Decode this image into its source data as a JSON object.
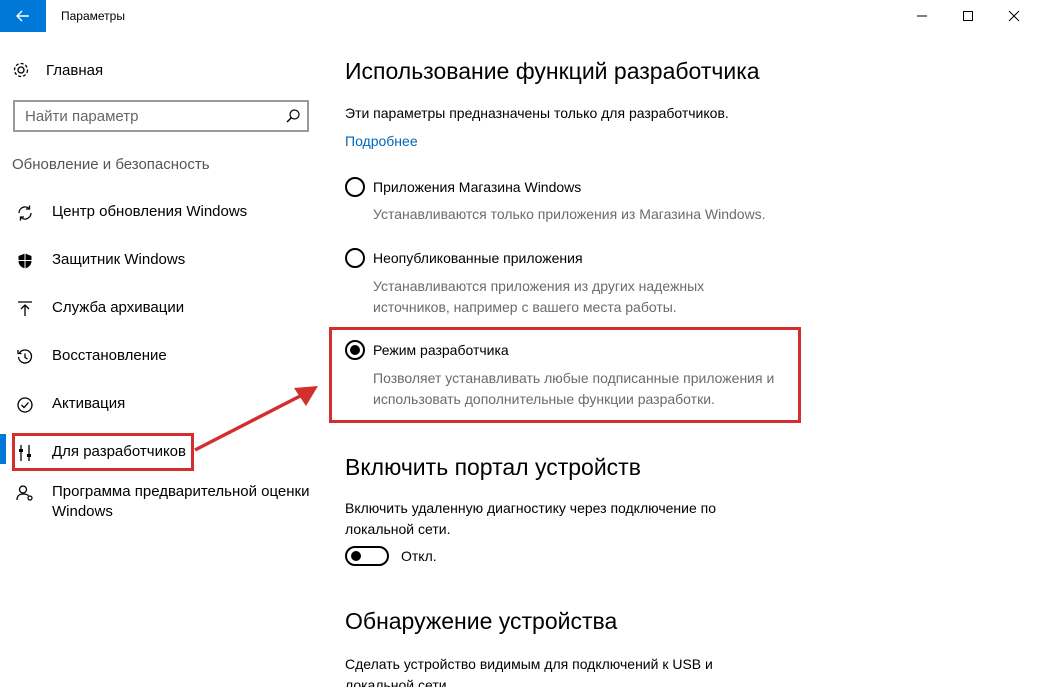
{
  "window": {
    "title": "Параметры"
  },
  "sidebar": {
    "home_label": "Главная",
    "search_placeholder": "Найти параметр",
    "section_label": "Обновление и безопасность",
    "items": [
      {
        "label": "Центр обновления Windows",
        "icon": "sync-icon"
      },
      {
        "label": "Защитник Windows",
        "icon": "shield-icon"
      },
      {
        "label": "Служба архивации",
        "icon": "upload-icon"
      },
      {
        "label": "Восстановление",
        "icon": "history-icon"
      },
      {
        "label": "Активация",
        "icon": "check-circle-icon"
      },
      {
        "label": "Для разработчиков",
        "icon": "developer-tools-icon",
        "selected": true
      },
      {
        "label": "Программа предварительной оценки Windows",
        "icon": "insider-icon"
      }
    ]
  },
  "main": {
    "heading": "Использование функций разработчика",
    "intro": "Эти параметры предназначены только для разработчиков.",
    "more_link": "Подробнее",
    "options": [
      {
        "label": "Приложения Магазина Windows",
        "description": "Устанавливаются только приложения из Магазина Windows.",
        "checked": false
      },
      {
        "label": "Неопубликованные приложения",
        "description": "Устанавливаются приложения из других надежных источников, например с вашего места работы.",
        "checked": false
      },
      {
        "label": "Режим разработчика",
        "description": "Позволяет устанавливать любые подписанные приложения и использовать дополнительные функции разработки.",
        "checked": true
      }
    ],
    "portal": {
      "heading": "Включить портал устройств",
      "description": "Включить удаленную диагностику через подключение по локальной сети.",
      "toggle_state": "Откл."
    },
    "discovery": {
      "heading": "Обнаружение устройства",
      "description": "Сделать устройство видимым для подключений к USB и локальной сети."
    }
  },
  "colors": {
    "accent": "#0078d7",
    "link": "#0067b8",
    "annotation": "#d32f2f"
  }
}
